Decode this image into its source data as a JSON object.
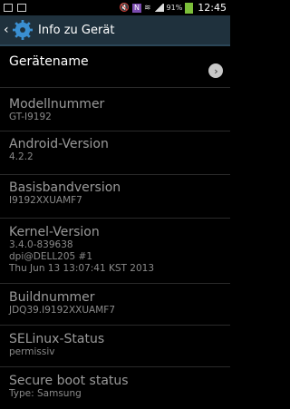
{
  "status_bar": {
    "battery_percent": "91%",
    "time": "12:45",
    "nfc_label": "N"
  },
  "action_bar": {
    "title": "Info zu Gerät"
  },
  "device_name": {
    "label": "Gerätename"
  },
  "items": [
    {
      "label": "Modellnummer",
      "lines": [
        "GT-I9192"
      ]
    },
    {
      "label": "Android-Version",
      "lines": [
        "4.2.2"
      ]
    },
    {
      "label": "Basisbandversion",
      "lines": [
        "I9192XXUAMF7"
      ]
    },
    {
      "label": "Kernel-Version",
      "lines": [
        "3.4.0-839638",
        "dpi@DELL205 #1",
        "Thu Jun 13 13:07:41 KST 2013"
      ]
    },
    {
      "label": "Buildnummer",
      "lines": [
        "JDQ39.I9192XXUAMF7"
      ]
    },
    {
      "label": "SELinux-Status",
      "lines": [
        "permissiv"
      ]
    },
    {
      "label": "Secure boot status",
      "lines": [
        "Type: Samsung"
      ]
    }
  ]
}
